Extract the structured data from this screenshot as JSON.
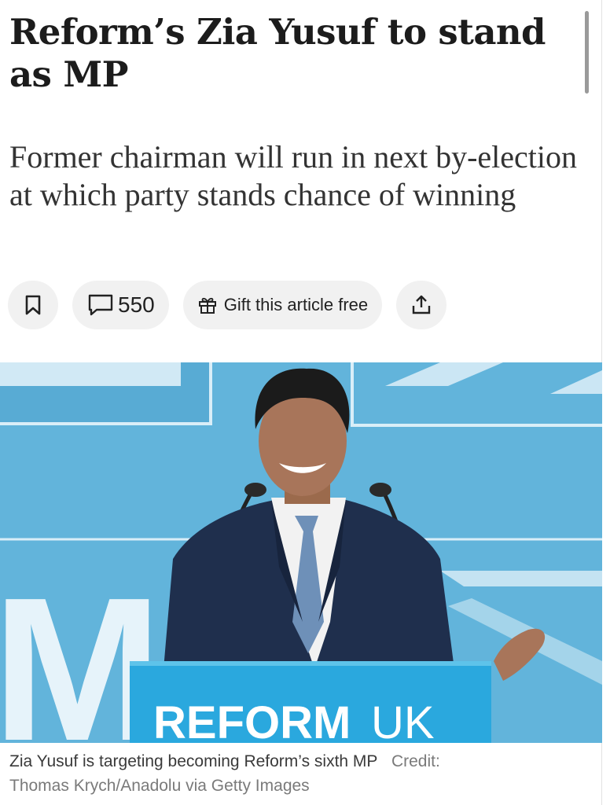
{
  "article": {
    "headline": "Reform’s Zia Yusuf to stand as MP",
    "subheadline": "Former chairman will run in next by-election at which party stands chance of winning"
  },
  "actions": {
    "comment_count": "550",
    "gift_label": "Gift this article free"
  },
  "image": {
    "podium_text_bold": "REFORM",
    "podium_text_light": "UK",
    "backdrop_letter": "M"
  },
  "caption": {
    "text": "Zia Yusuf is targeting becoming Reform’s sixth MP",
    "credit_label": "Credit:",
    "credit": "Thomas Krych/Anadolu via Getty Images"
  },
  "icons": [
    "bookmark-icon",
    "comment-icon",
    "gift-icon",
    "share-icon"
  ],
  "colors": {
    "headline": "#1c1c1c",
    "pill_background": "#f1f1f1",
    "backdrop_blue": "#5fb1d8",
    "podium_blue": "#29a9df"
  }
}
